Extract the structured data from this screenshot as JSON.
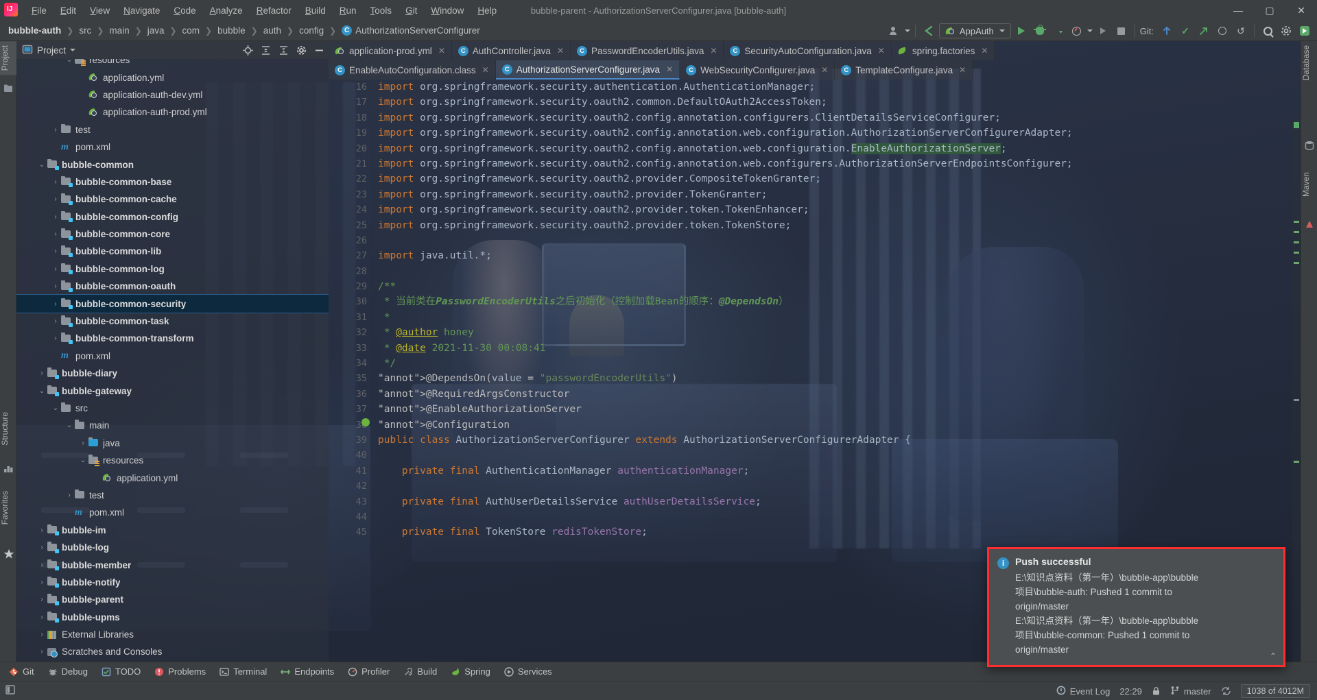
{
  "window": {
    "title": "bubble-parent - AuthorizationServerConfigurer.java [bubble-auth]",
    "minimize": "—",
    "maximize": "▢",
    "close": "✕"
  },
  "menu": [
    {
      "label": "File"
    },
    {
      "label": "Edit"
    },
    {
      "label": "View"
    },
    {
      "label": "Navigate"
    },
    {
      "label": "Code"
    },
    {
      "label": "Analyze"
    },
    {
      "label": "Refactor"
    },
    {
      "label": "Build"
    },
    {
      "label": "Run"
    },
    {
      "label": "Tools"
    },
    {
      "label": "Git"
    },
    {
      "label": "Window"
    },
    {
      "label": "Help"
    }
  ],
  "breadcrumb": {
    "items": [
      "bubble-auth",
      "src",
      "main",
      "java",
      "com",
      "bubble",
      "auth",
      "config"
    ],
    "class_icon": "C",
    "class_name": "AuthorizationServerConfigurer",
    "separator": "❯"
  },
  "toolbar": {
    "run_config": "AppAuth",
    "run_config_chevron": "▾",
    "git_label": "Git:",
    "icons": [
      "profiler-user-icon",
      "back-arrow-icon",
      "run-icon",
      "debug-icon",
      "run-coverage-icon",
      "profiler-icon",
      "dropdown-icon",
      "run-anything-icon",
      "stop-icon"
    ],
    "right_icons": [
      "git-update-icon",
      "git-commit-icon",
      "git-push-icon",
      "history-icon",
      "rollback-icon",
      "search-everywhere-icon",
      "settings-icon",
      "ide-icon"
    ]
  },
  "left_tool_strip": [
    {
      "label": "Project",
      "selected": true,
      "icon": "project-icon"
    },
    {
      "label": "Structure",
      "selected": false,
      "icon": "structure-icon"
    },
    {
      "label": "Favorites",
      "selected": false,
      "icon": "star-icon"
    }
  ],
  "right_tool_strip": [
    {
      "label": "Database",
      "icon": "database-icon"
    },
    {
      "label": "Maven",
      "icon": "maven-icon"
    }
  ],
  "project_panel": {
    "title": "Project",
    "chevron": "▾",
    "actions": [
      "locate-icon",
      "expand-all-icon",
      "collapse-all-icon",
      "settings-icon",
      "hide-icon"
    ],
    "tree": [
      {
        "label": "resources",
        "depth": 3,
        "arrow": "v",
        "icon": "resources-folder",
        "bold": false,
        "selected": false,
        "partial": true
      },
      {
        "label": "application.yml",
        "depth": 4,
        "arrow": "",
        "icon": "yml",
        "bold": false,
        "selected": false
      },
      {
        "label": "application-auth-dev.yml",
        "depth": 4,
        "arrow": "",
        "icon": "yml",
        "bold": false,
        "selected": false
      },
      {
        "label": "application-auth-prod.yml",
        "depth": 4,
        "arrow": "",
        "icon": "yml",
        "bold": false,
        "selected": false
      },
      {
        "label": "test",
        "depth": 2,
        "arrow": ">",
        "icon": "folder",
        "bold": false,
        "selected": false
      },
      {
        "label": "pom.xml",
        "depth": 2,
        "arrow": "",
        "icon": "maven",
        "bold": false,
        "selected": false
      },
      {
        "label": "bubble-common",
        "depth": 1,
        "arrow": "v",
        "icon": "module",
        "bold": true,
        "selected": false
      },
      {
        "label": "bubble-common-base",
        "depth": 2,
        "arrow": ">",
        "icon": "module",
        "bold": true,
        "selected": false
      },
      {
        "label": "bubble-common-cache",
        "depth": 2,
        "arrow": ">",
        "icon": "module",
        "bold": true,
        "selected": false
      },
      {
        "label": "bubble-common-config",
        "depth": 2,
        "arrow": ">",
        "icon": "module",
        "bold": true,
        "selected": false
      },
      {
        "label": "bubble-common-core",
        "depth": 2,
        "arrow": ">",
        "icon": "module",
        "bold": true,
        "selected": false
      },
      {
        "label": "bubble-common-lib",
        "depth": 2,
        "arrow": ">",
        "icon": "module",
        "bold": true,
        "selected": false
      },
      {
        "label": "bubble-common-log",
        "depth": 2,
        "arrow": ">",
        "icon": "module",
        "bold": true,
        "selected": false
      },
      {
        "label": "bubble-common-oauth",
        "depth": 2,
        "arrow": ">",
        "icon": "module",
        "bold": true,
        "selected": false
      },
      {
        "label": "bubble-common-security",
        "depth": 2,
        "arrow": ">",
        "icon": "module",
        "bold": true,
        "selected": true
      },
      {
        "label": "bubble-common-task",
        "depth": 2,
        "arrow": ">",
        "icon": "module",
        "bold": true,
        "selected": false
      },
      {
        "label": "bubble-common-transform",
        "depth": 2,
        "arrow": ">",
        "icon": "module",
        "bold": true,
        "selected": false
      },
      {
        "label": "pom.xml",
        "depth": 2,
        "arrow": "",
        "icon": "maven",
        "bold": false,
        "selected": false
      },
      {
        "label": "bubble-diary",
        "depth": 1,
        "arrow": ">",
        "icon": "module",
        "bold": true,
        "selected": false
      },
      {
        "label": "bubble-gateway",
        "depth": 1,
        "arrow": "v",
        "icon": "module",
        "bold": true,
        "selected": false
      },
      {
        "label": "src",
        "depth": 2,
        "arrow": "v",
        "icon": "folder",
        "bold": false,
        "selected": false
      },
      {
        "label": "main",
        "depth": 3,
        "arrow": "v",
        "icon": "folder",
        "bold": false,
        "selected": false
      },
      {
        "label": "java",
        "depth": 4,
        "arrow": ">",
        "icon": "source-folder",
        "bold": false,
        "selected": false
      },
      {
        "label": "resources",
        "depth": 4,
        "arrow": "v",
        "icon": "resources-folder",
        "bold": false,
        "selected": false
      },
      {
        "label": "application.yml",
        "depth": 5,
        "arrow": "",
        "icon": "yml",
        "bold": false,
        "selected": false
      },
      {
        "label": "test",
        "depth": 3,
        "arrow": ">",
        "icon": "folder",
        "bold": false,
        "selected": false
      },
      {
        "label": "pom.xml",
        "depth": 3,
        "arrow": "",
        "icon": "maven",
        "bold": false,
        "selected": false
      },
      {
        "label": "bubble-im",
        "depth": 1,
        "arrow": ">",
        "icon": "module",
        "bold": true,
        "selected": false
      },
      {
        "label": "bubble-log",
        "depth": 1,
        "arrow": ">",
        "icon": "module",
        "bold": true,
        "selected": false
      },
      {
        "label": "bubble-member",
        "depth": 1,
        "arrow": ">",
        "icon": "module",
        "bold": true,
        "selected": false
      },
      {
        "label": "bubble-notify",
        "depth": 1,
        "arrow": ">",
        "icon": "module",
        "bold": true,
        "selected": false
      },
      {
        "label": "bubble-parent",
        "depth": 1,
        "arrow": ">",
        "icon": "module",
        "bold": true,
        "selected": false
      },
      {
        "label": "bubble-upms",
        "depth": 1,
        "arrow": ">",
        "icon": "module",
        "bold": true,
        "selected": false
      },
      {
        "label": "External Libraries",
        "depth": 1,
        "arrow": ">",
        "icon": "library",
        "bold": false,
        "selected": false
      },
      {
        "label": "Scratches and Consoles",
        "depth": 1,
        "arrow": ">",
        "icon": "scratch",
        "bold": false,
        "selected": false
      }
    ]
  },
  "editor": {
    "tabs_row1": [
      {
        "label": "application-prod.yml",
        "icon": "yml",
        "active": false,
        "close": "✕"
      },
      {
        "label": "AuthController.java",
        "icon": "class",
        "active": false,
        "close": "✕"
      },
      {
        "label": "PasswordEncoderUtils.java",
        "icon": "class",
        "active": false,
        "close": "✕"
      },
      {
        "label": "SecurityAutoConfiguration.java",
        "icon": "class",
        "active": false,
        "close": "✕"
      },
      {
        "label": "spring.factories",
        "icon": "factories",
        "active": false,
        "close": "✕"
      }
    ],
    "tabs_row2": [
      {
        "label": "EnableAutoConfiguration.class",
        "icon": "class",
        "active": false,
        "close": "✕"
      },
      {
        "label": "AuthorizationServerConfigurer.java",
        "icon": "class",
        "active": true,
        "close": "✕"
      },
      {
        "label": "WebSecurityConfigurer.java",
        "icon": "class",
        "active": false,
        "close": "✕"
      },
      {
        "label": "TemplateConfigure.java",
        "icon": "class",
        "active": false,
        "close": "✕"
      }
    ],
    "first_line_number": 16,
    "lines": [
      {
        "n": 16,
        "text": "import org.springframework.security.authentication.AuthenticationManager;"
      },
      {
        "n": 17,
        "text": "import org.springframework.security.oauth2.common.DefaultOAuth2AccessToken;"
      },
      {
        "n": 18,
        "text": "import org.springframework.security.oauth2.config.annotation.configurers.ClientDetailsServiceConfigurer;"
      },
      {
        "n": 19,
        "text": "import org.springframework.security.oauth2.config.annotation.web.configuration.AuthorizationServerConfigurerAdapter;"
      },
      {
        "n": 20,
        "text": "import org.springframework.security.oauth2.config.annotation.web.configuration.EnableAuthorizationServer;"
      },
      {
        "n": 21,
        "text": "import org.springframework.security.oauth2.config.annotation.web.configurers.AuthorizationServerEndpointsConfigurer;"
      },
      {
        "n": 22,
        "text": "import org.springframework.security.oauth2.provider.CompositeTokenGranter;"
      },
      {
        "n": 23,
        "text": "import org.springframework.security.oauth2.provider.TokenGranter;"
      },
      {
        "n": 24,
        "text": "import org.springframework.security.oauth2.provider.token.TokenEnhancer;"
      },
      {
        "n": 25,
        "text": "import org.springframework.security.oauth2.provider.token.TokenStore;"
      },
      {
        "n": 26,
        "text": ""
      },
      {
        "n": 27,
        "text": "import java.util.*;"
      },
      {
        "n": 28,
        "text": ""
      },
      {
        "n": 29,
        "text": "/**"
      },
      {
        "n": 30,
        "text": " * 当前类在PasswordEncoderUtils之后初始化（控制加载Bean的顺序：@DependsOn）"
      },
      {
        "n": 31,
        "text": " *"
      },
      {
        "n": 32,
        "text": " * @author honey"
      },
      {
        "n": 33,
        "text": " * @date 2021-11-30 00:08:41"
      },
      {
        "n": 34,
        "text": " */"
      },
      {
        "n": 35,
        "text": "@DependsOn(value = \"passwordEncoderUtils\")"
      },
      {
        "n": 36,
        "text": "@RequiredArgsConstructor"
      },
      {
        "n": 37,
        "text": "@EnableAuthorizationServer"
      },
      {
        "n": 38,
        "text": "@Configuration"
      },
      {
        "n": 39,
        "text": "public class AuthorizationServerConfigurer extends AuthorizationServerConfigurerAdapter {"
      },
      {
        "n": 40,
        "text": ""
      },
      {
        "n": 41,
        "text": "    private final AuthenticationManager authenticationManager;"
      },
      {
        "n": 42,
        "text": ""
      },
      {
        "n": 43,
        "text": "    private final AuthUserDetailsService authUserDetailsService;"
      },
      {
        "n": 44,
        "text": ""
      },
      {
        "n": 45,
        "text": "    private final TokenStore redisTokenStore;"
      }
    ]
  },
  "notification": {
    "icon": "info-icon",
    "title": "Push successful",
    "lines": [
      "E:\\知识点资料（第一年）\\bubble-app\\bubble",
      "项目\\bubble-auth: Pushed 1 commit to",
      "origin/master",
      "E:\\知识点资料（第一年）\\bubble-app\\bubble",
      "项目\\bubble-common: Pushed 1 commit to",
      "origin/master"
    ],
    "collapse_chevron": "⌃",
    "border_color": "#ff2d2d"
  },
  "bottom_tool_bar": [
    {
      "label": "Git",
      "icon": "git-icon"
    },
    {
      "label": "Debug",
      "icon": "debug-icon"
    },
    {
      "label": "TODO",
      "icon": "todo-icon"
    },
    {
      "label": "Problems",
      "icon": "problems-icon"
    },
    {
      "label": "Terminal",
      "icon": "terminal-icon"
    },
    {
      "label": "Endpoints",
      "icon": "endpoints-icon"
    },
    {
      "label": "Profiler",
      "icon": "profiler-icon"
    },
    {
      "label": "Build",
      "icon": "build-icon"
    },
    {
      "label": "Spring",
      "icon": "spring-icon"
    },
    {
      "label": "Services",
      "icon": "services-icon"
    }
  ],
  "status_bar": {
    "event_log": "Event Log",
    "time": "22:29",
    "branch": "master",
    "memory": "1038 of 4012M",
    "lock_icon": "lock-icon",
    "sync_icon": "sync-icon"
  },
  "colors": {
    "accent": "#3592c4",
    "chrome": "#3c3f41",
    "editor_bg": "#2b2b2b",
    "selection": "#0d293e",
    "keyword": "#cc7832",
    "string": "#6a8759",
    "comment": "#629755",
    "annotation": "#bbb529",
    "field": "#9876aa",
    "plain": "#a9b7c6",
    "green": "#59a869",
    "notif_border": "#ff2d2d"
  }
}
